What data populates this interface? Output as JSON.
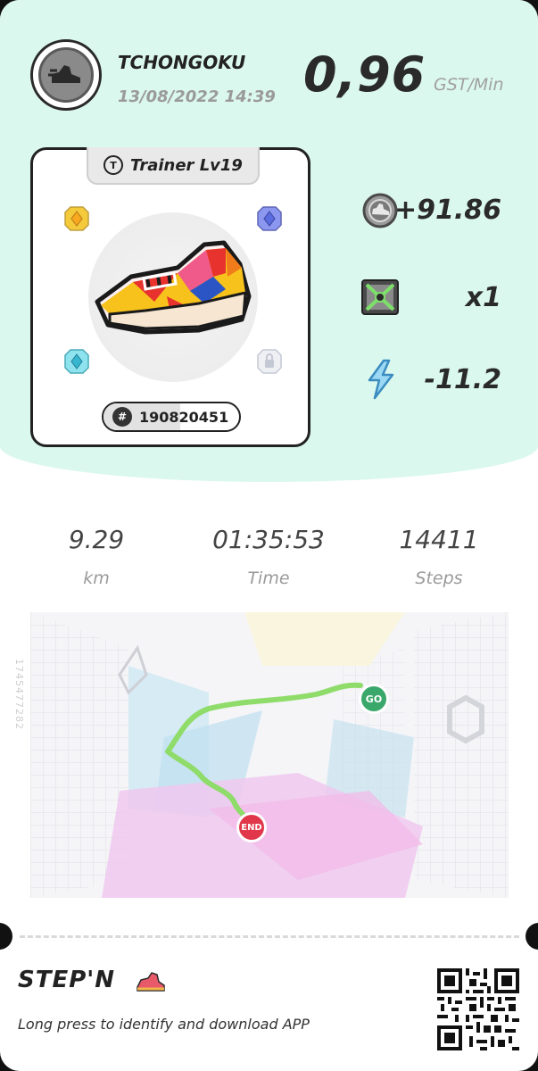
{
  "profile": {
    "username": "TCHONGOKU",
    "datetime": "13/08/2022 14:39",
    "avatar_icon": "sneaker-icon"
  },
  "earnings": {
    "value": "0,96",
    "unit": "GST/Min"
  },
  "shoe": {
    "level_label": "Trainer Lv19",
    "type_icon": "T",
    "id": "190820451",
    "id_prefix": "#",
    "sockets": [
      "yellow-gem",
      "blue-gem",
      "cyan-gem",
      "locked-gem"
    ]
  },
  "stats": [
    {
      "icon": "gst-coin-icon",
      "value": "+91.86"
    },
    {
      "icon": "mystery-box-icon",
      "value": "x1"
    },
    {
      "icon": "energy-bolt-icon",
      "value": "-11.2"
    }
  ],
  "metrics": [
    {
      "value": "9.29",
      "label": "km"
    },
    {
      "value": "01:35:53",
      "label": "Time"
    },
    {
      "value": "14411",
      "label": "Steps"
    }
  ],
  "map": {
    "start_label": "GO",
    "end_label": "END",
    "watermark": "1745477282"
  },
  "footer": {
    "logo": "STEP'N",
    "tagline": "Long press to identify and download APP"
  },
  "colors": {
    "header_bg": "#dbf8ee",
    "route": "#8fdc6a",
    "go": "#3aa86a",
    "end": "#e0384a"
  }
}
